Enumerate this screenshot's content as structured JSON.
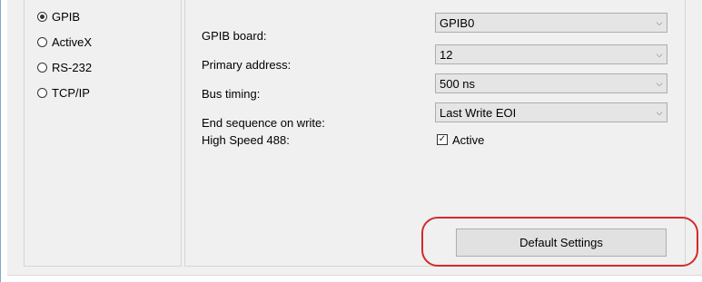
{
  "interfaces": {
    "options": [
      {
        "label": "GPIB",
        "checked": true
      },
      {
        "label": "ActiveX",
        "checked": false
      },
      {
        "label": "RS-232",
        "checked": false
      },
      {
        "label": "TCP/IP",
        "checked": false
      }
    ]
  },
  "settings": {
    "gpib_board": {
      "label": "GPIB board:",
      "value": "GPIB0"
    },
    "primary_address": {
      "label": "Primary address:",
      "value": "12"
    },
    "bus_timing": {
      "label": "Bus timing:",
      "value": "500 ns"
    },
    "end_sequence": {
      "label": "End sequence on write:",
      "value": "Last Write EOI"
    },
    "high_speed": {
      "label": "High Speed 488:",
      "check_label": "Active",
      "checked": true
    }
  },
  "buttons": {
    "default_settings": "Default Settings"
  },
  "icons": {
    "dropdown": "chevron-down-icon",
    "check": "checkmark-icon"
  },
  "colors": {
    "highlight": "#d42a2a",
    "panel": "#f0f0f0",
    "accent_border": "#7fa9c9"
  }
}
